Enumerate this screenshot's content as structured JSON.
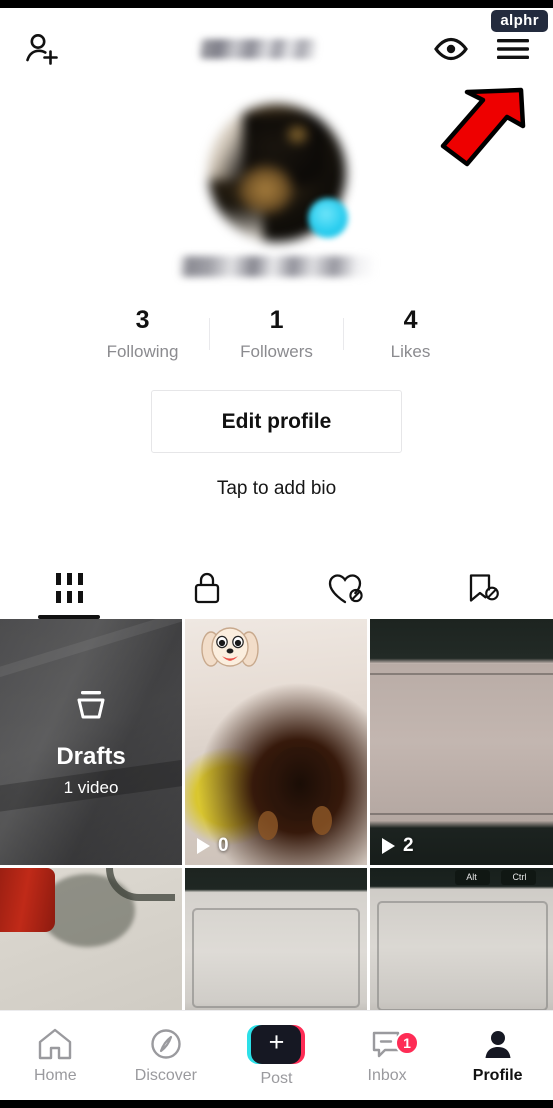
{
  "watermark": {
    "label": "alphr"
  },
  "header": {
    "title_blurred": true,
    "add_friend_icon": "add-friend-icon",
    "visitor_icon": "eye-icon",
    "menu_icon": "hamburger-menu-icon"
  },
  "annotation": {
    "type": "red-arrow",
    "color": "#ee0000",
    "outline_color": "#000000",
    "points_to": "hamburger-menu-icon"
  },
  "profile": {
    "avatar_blurred": true,
    "avatar_badge": "add-profile-badge",
    "username_blurred": true,
    "bio_placeholder": "Tap to add bio",
    "edit_button_label": "Edit profile",
    "stats": [
      {
        "value": "3",
        "label": "Following"
      },
      {
        "value": "1",
        "label": "Followers"
      },
      {
        "value": "4",
        "label": "Likes"
      }
    ]
  },
  "tabs": [
    {
      "icon": "grid-icon",
      "name": "videos",
      "active": true
    },
    {
      "icon": "lock-icon",
      "name": "private",
      "active": false
    },
    {
      "icon": "heart-slash-icon",
      "name": "liked-hidden",
      "active": false
    },
    {
      "icon": "bookmark-slash-icon",
      "name": "saved-hidden",
      "active": false
    }
  ],
  "grid": {
    "drafts": {
      "label": "Drafts",
      "sub": "1 video",
      "icon": "drafts-tray-icon"
    },
    "videos": [
      {
        "play_count": "0",
        "has_sticker": true,
        "sticker": "dog-emoji-sticker"
      },
      {
        "play_count": "2",
        "has_sticker": false
      },
      {
        "play_count": "",
        "has_sticker": false
      },
      {
        "play_count": "",
        "has_sticker": false
      },
      {
        "play_count": "",
        "has_sticker": false
      }
    ]
  },
  "bottom_nav": {
    "items": [
      {
        "label": "Home",
        "icon": "home-icon",
        "active": false,
        "badge": ""
      },
      {
        "label": "Discover",
        "icon": "compass-icon",
        "active": false,
        "badge": ""
      },
      {
        "label": "Post",
        "icon": "plus-icon",
        "active": false,
        "badge": ""
      },
      {
        "label": "Inbox",
        "icon": "message-icon",
        "active": false,
        "badge": "1"
      },
      {
        "label": "Profile",
        "icon": "person-icon",
        "active": true,
        "badge": ""
      }
    ]
  },
  "colors": {
    "tiktok_cyan": "#2ce0e8",
    "tiktok_pink": "#fe2c55",
    "badge_red": "#fe2c55",
    "text_dark": "#111111",
    "text_muted": "#9a9a9e",
    "watermark_bg": "#232b3e"
  }
}
